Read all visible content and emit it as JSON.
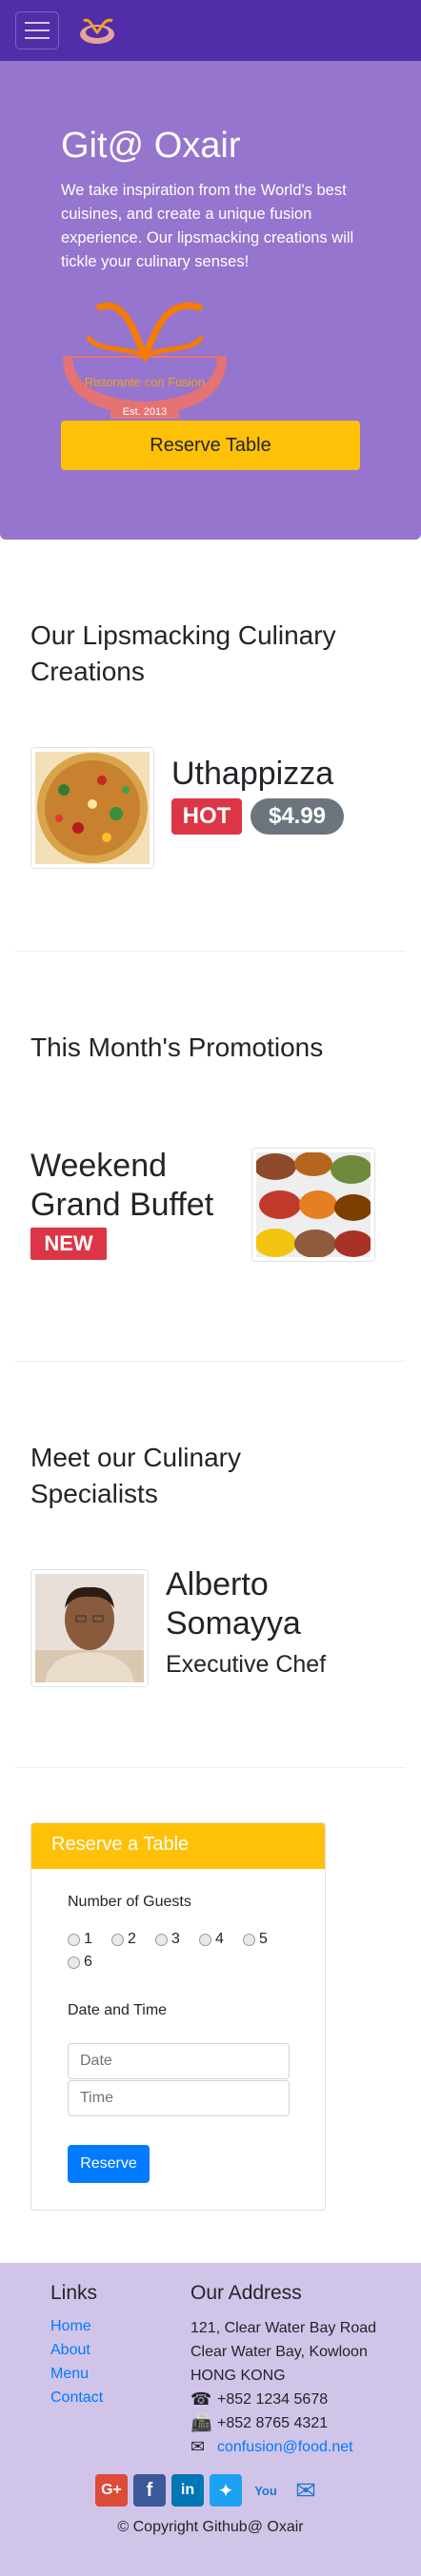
{
  "navbar": {
    "menu_icon": "hamburger-icon",
    "logo_icon": "restaurant-logo-icon",
    "brand_color": "#512da8"
  },
  "jumbotron": {
    "title": "Git@ Oxair",
    "text": "We take inspiration from the World's best cuisines, and create a unique fusion experience. Our lipsmacking creations will tickle your culinary senses!",
    "logo_text": "Ristorante con Fusion",
    "logo_est": "Est. 2013",
    "reserve_label": "Reserve Table",
    "bg_color": "#9575cd"
  },
  "dish_section": {
    "title": "Our Lipsmacking Culinary Creations",
    "dish_name": "Uthappizza",
    "badge": "HOT",
    "price": "$4.99"
  },
  "promo_section": {
    "title": "This Month's Promotions",
    "promo_name": "Weekend Grand Buffet",
    "badge": "NEW"
  },
  "leader_section": {
    "title": "Meet our Culinary Specialists",
    "name": "Alberto Somayya",
    "designation": "Executive Chef"
  },
  "reserve_card": {
    "header": "Reserve a Table",
    "guests_label": "Number of Guests",
    "guest_options": [
      "1",
      "2",
      "3",
      "4",
      "5",
      "6"
    ],
    "datetime_label": "Date and Time",
    "date_placeholder": "Date",
    "time_placeholder": "Time",
    "submit_label": "Reserve"
  },
  "footer": {
    "links_title": "Links",
    "links": [
      "Home",
      "About",
      "Menu",
      "Contact"
    ],
    "address_title": "Our Address",
    "address_lines": [
      "121, Clear Water Bay Road",
      "Clear Water Bay, Kowloon",
      "HONG KONG"
    ],
    "phone": "+852 1234 5678",
    "fax": "+852 8765 4321",
    "email": "confusion@food.net",
    "social_icons": [
      "google-plus-icon",
      "facebook-icon",
      "linkedin-icon",
      "twitter-icon",
      "youtube-icon",
      "mail-icon"
    ],
    "copyright": "© Copyright Github@ Oxair"
  }
}
